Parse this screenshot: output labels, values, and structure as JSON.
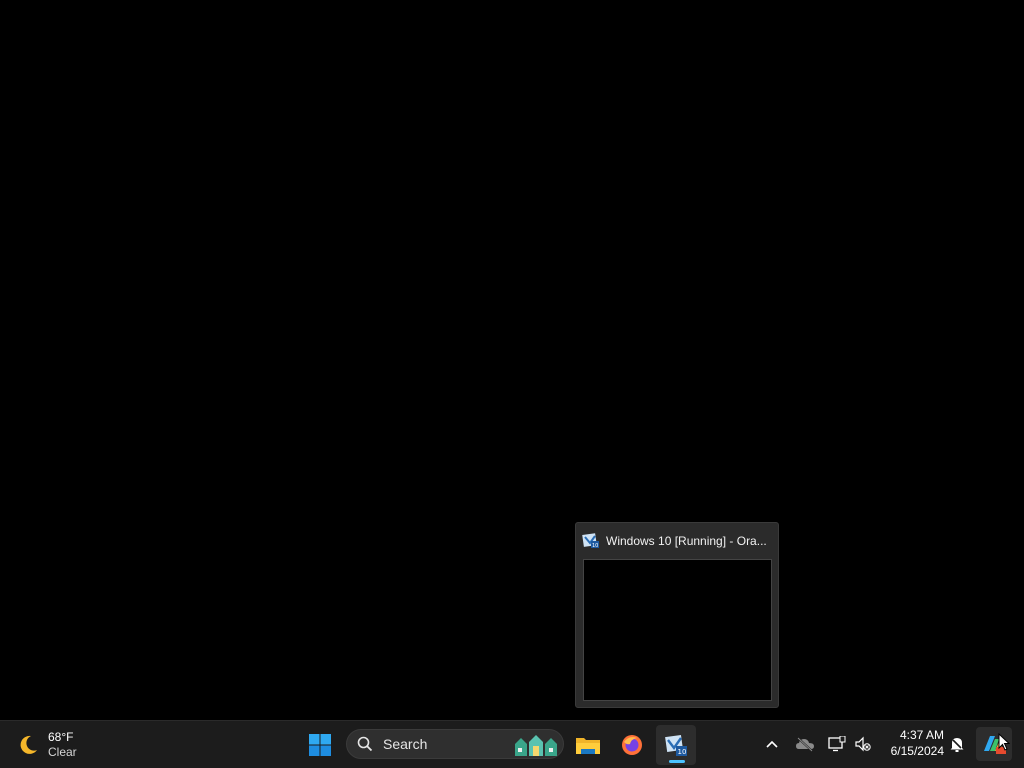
{
  "preview": {
    "title": "Windows 10 [Running] - Ora..."
  },
  "taskbar": {
    "weather": {
      "temperature": "68°F",
      "condition": "Clear",
      "icon": "moon-icon"
    },
    "start": {
      "icon": "windows-logo-icon"
    },
    "search": {
      "label": "Search",
      "icon": "search-icon"
    },
    "pinned": [
      {
        "name": "File Explorer",
        "icon": "folder-icon"
      },
      {
        "name": "Firefox",
        "icon": "firefox-icon"
      },
      {
        "name": "Oracle VM VirtualBox",
        "icon": "virtualbox-icon",
        "active": true
      }
    ],
    "tray": {
      "icons": [
        "chevron-up-icon",
        "onedrive-icon",
        "network-icon",
        "volume-muted-icon"
      ],
      "time": "4:37 AM",
      "date": "6/15/2024",
      "notification_icon": "notification-bell-icon"
    }
  },
  "colors": {
    "accent": "#4cc2ff",
    "taskbar": "#1c1c1c",
    "desktop": "#000000"
  }
}
